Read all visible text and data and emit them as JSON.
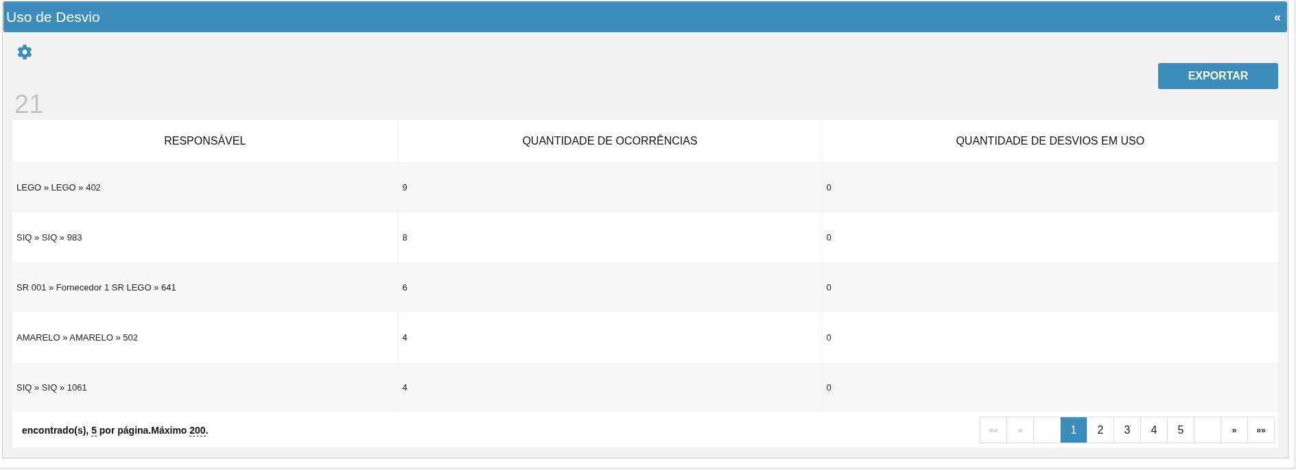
{
  "panel": {
    "title": "Uso de Desvio",
    "collapse": "«"
  },
  "toolbar": {
    "export_button": "EXPORTAR"
  },
  "count": "21",
  "table": {
    "columns": [
      "RESPONSÁVEL",
      "QUANTIDADE DE OCORRÊNCIAS",
      "QUANTIDADE DE DESVIOS EM USO"
    ],
    "rows": [
      [
        "LEGO » LEGO » 402",
        "9",
        "0"
      ],
      [
        "SIQ » SIQ » 983",
        "8",
        "0"
      ],
      [
        "SR 001 » Fornecedor 1 SR LEGO » 641",
        "6",
        "0"
      ],
      [
        "AMARELO » AMARELO » 502",
        "4",
        "0"
      ],
      [
        "SIQ » SIQ » 1061",
        "4",
        "0"
      ]
    ]
  },
  "footer": {
    "summary": {
      "prefix": "encontrado(s), ",
      "per_page": "5",
      "middle": " por página.Máximo ",
      "max": "200",
      "suffix": "."
    }
  },
  "pagination": [
    {
      "kind": "first",
      "label": "««",
      "disabled": true
    },
    {
      "kind": "prev",
      "label": "«",
      "disabled": true
    },
    {
      "kind": "blank"
    },
    {
      "kind": "page",
      "label": "1",
      "selected": true
    },
    {
      "kind": "page",
      "label": "2",
      "selected": false
    },
    {
      "kind": "page",
      "label": "3",
      "selected": false
    },
    {
      "kind": "page",
      "label": "4",
      "selected": false
    },
    {
      "kind": "page",
      "label": "5",
      "selected": false
    },
    {
      "kind": "blank"
    },
    {
      "kind": "next",
      "label": "»",
      "disabled": false
    },
    {
      "kind": "last",
      "label": "»»",
      "disabled": false
    }
  ]
}
